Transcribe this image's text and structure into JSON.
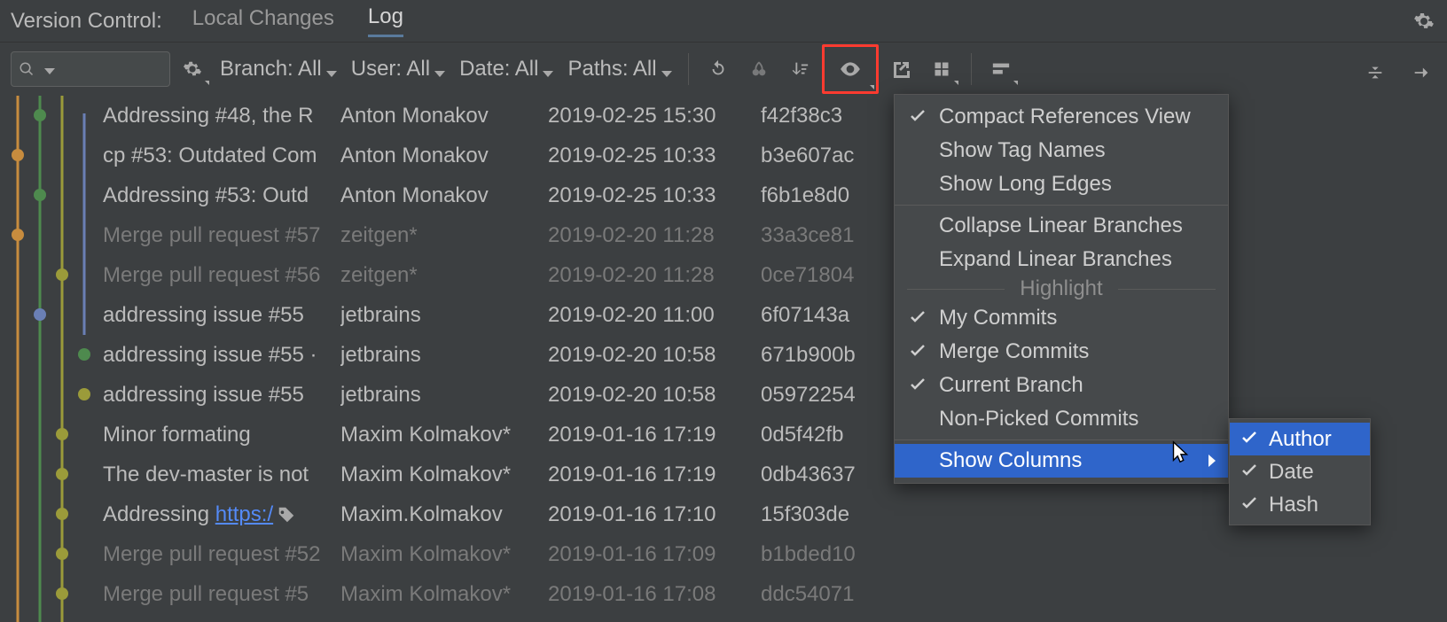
{
  "header": {
    "title": "Version Control:",
    "tabs": [
      "Local Changes",
      "Log"
    ],
    "active_tab": 1
  },
  "toolbar": {
    "filters": {
      "branch_label": "Branch: All",
      "user_label": "User: All",
      "date_label": "Date: All",
      "paths_label": "Paths: All"
    }
  },
  "commits": [
    {
      "subject": "Addressing #48, the R",
      "author": "Anton Monakov",
      "date": "2019-02-25 15:30",
      "hash": "f42f38c3",
      "dim": false
    },
    {
      "subject": "cp #53: Outdated Com",
      "author": "Anton Monakov",
      "date": "2019-02-25 10:33",
      "hash": "b3e607ac",
      "dim": false
    },
    {
      "subject": "Addressing #53: Outd",
      "author": "Anton Monakov",
      "date": "2019-02-25 10:33",
      "hash": "f6b1e8d0",
      "dim": false
    },
    {
      "subject": "Merge pull request #57",
      "author": "zeitgen*",
      "date": "2019-02-20 11:28",
      "hash": "33a3ce81",
      "dim": true
    },
    {
      "subject": "Merge pull request #56",
      "author": "zeitgen*",
      "date": "2019-02-20 11:28",
      "hash": "0ce71804",
      "dim": true
    },
    {
      "subject": "addressing issue #55",
      "author": "jetbrains",
      "date": "2019-02-20 11:00",
      "hash": "6f07143a",
      "dim": false
    },
    {
      "subject": "addressing issue #55 ·",
      "author": "jetbrains",
      "date": "2019-02-20 10:58",
      "hash": "671b900b",
      "dim": false
    },
    {
      "subject": "addressing issue #55",
      "author": "jetbrains",
      "date": "2019-02-20 10:58",
      "hash": "05972254",
      "dim": false
    },
    {
      "subject": "Minor formating",
      "author": "Maxim Kolmakov*",
      "date": "2019-01-16 17:19",
      "hash": "0d5f42fb",
      "dim": false
    },
    {
      "subject": "The dev-master is not",
      "author": "Maxim Kolmakov*",
      "date": "2019-01-16 17:19",
      "hash": "0db43637",
      "dim": false
    },
    {
      "subject": "Addressing ",
      "subject_link": "https:/",
      "author": "Maxim.Kolmakov",
      "date": "2019-01-16 17:10",
      "hash": "15f303de",
      "dim": false,
      "has_tag": true
    },
    {
      "subject": "Merge pull request #52",
      "author": "Maxim Kolmakov*",
      "date": "2019-01-16 17:09",
      "hash": "b1bded10",
      "dim": true
    },
    {
      "subject": "Merge pull request #5",
      "author": "Maxim Kolmakov*",
      "date": "2019-01-16 17:08",
      "hash": "ddc54071",
      "dim": true
    }
  ],
  "menu": {
    "group1": [
      {
        "label": "Compact References View",
        "checked": true
      },
      {
        "label": "Show Tag Names",
        "checked": false
      },
      {
        "label": "Show Long Edges",
        "checked": false
      }
    ],
    "group2": [
      {
        "label": "Collapse Linear Branches"
      },
      {
        "label": "Expand Linear Branches"
      }
    ],
    "highlight_header": "Highlight",
    "group3": [
      {
        "label": "My Commits",
        "checked": true
      },
      {
        "label": "Merge Commits",
        "checked": true
      },
      {
        "label": "Current Branch",
        "checked": true
      },
      {
        "label": "Non-Picked Commits",
        "checked": false
      }
    ],
    "show_columns_label": "Show Columns",
    "columns": [
      {
        "label": "Author",
        "checked": true,
        "selected": true
      },
      {
        "label": "Date",
        "checked": true
      },
      {
        "label": "Hash",
        "checked": true
      }
    ]
  }
}
